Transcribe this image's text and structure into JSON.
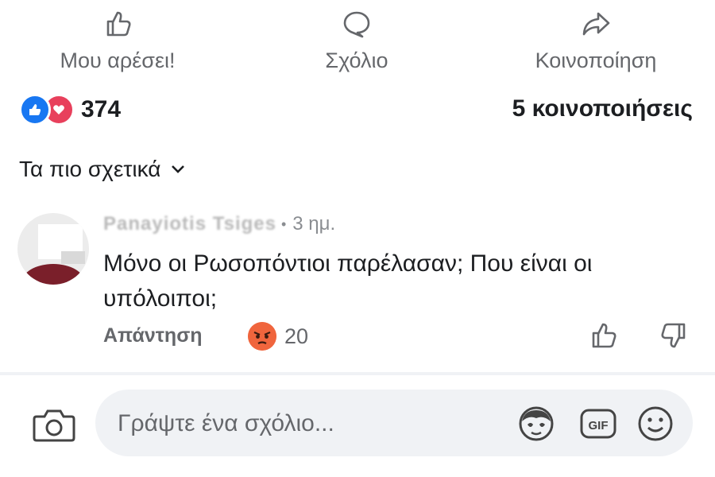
{
  "actions": [
    {
      "label": "Μου αρέσει!",
      "icon": "thumbs-up-icon"
    },
    {
      "label": "Σχόλιο",
      "icon": "comment-bubble-icon"
    },
    {
      "label": "Κοινοποίηση",
      "icon": "share-arrow-icon"
    }
  ],
  "reactions": {
    "count": "374",
    "icons": [
      "like-icon",
      "love-icon"
    ],
    "like_color": "#1877f2",
    "love_color": "#e8405c"
  },
  "shares": "5 κοινοποιήσεις",
  "sort": {
    "label": "Τα πιο σχετικά",
    "icon": "chevron-down-icon"
  },
  "comment": {
    "author": "Panayiotis Tsiges",
    "time": "3 ημ.",
    "text": "Μόνο οι Ρωσοπόντιοι παρέλασαν; Που είναι οι υπόλοιποι;",
    "reply_label": "Απάντηση",
    "reaction": {
      "icon": "angry-face-icon",
      "count": "20",
      "color": "#f0653d"
    }
  },
  "composer": {
    "placeholder": "Γράψτε ένα σχόλιο...",
    "icons": [
      "camera-icon",
      "avatar-sticker-icon",
      "gif-icon",
      "emoji-icon"
    ]
  }
}
